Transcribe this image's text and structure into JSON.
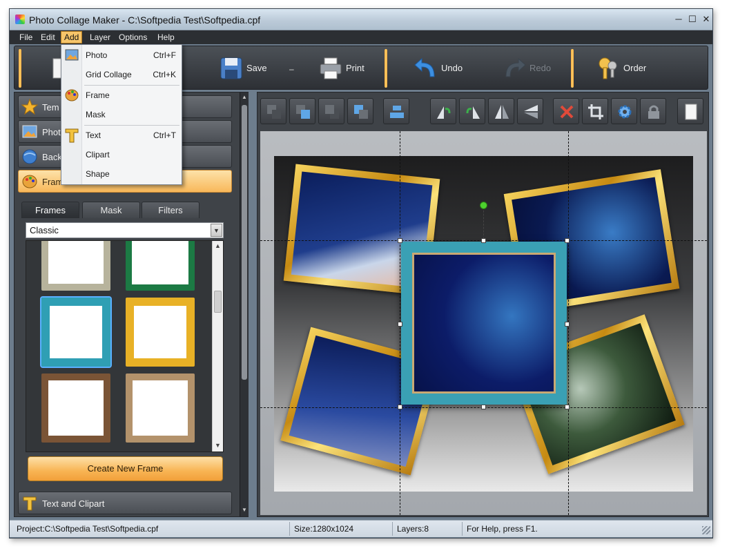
{
  "window": {
    "title": "Photo Collage Maker - C:\\Softpedia Test\\Softpedia.cpf",
    "minimize": "─",
    "maximize": "☐",
    "close": "✕"
  },
  "menubar": {
    "items": [
      "File",
      "Edit",
      "Add",
      "Layer",
      "Options",
      "Help"
    ],
    "active": "Add"
  },
  "toolbar": {
    "save_label": "Save",
    "print_label": "Print",
    "undo_label": "Undo",
    "redo_label": "Redo",
    "order_label": "Order",
    "dash": "–"
  },
  "add_menu": {
    "items": [
      {
        "label": "Photo",
        "shortcut": "Ctrl+F",
        "icon": "photo-icon"
      },
      {
        "label": "Grid Collage",
        "shortcut": "Ctrl+K",
        "icon": ""
      },
      {
        "label": "Frame",
        "shortcut": "",
        "icon": "palette-icon"
      },
      {
        "label": "Mask",
        "shortcut": "",
        "icon": ""
      },
      {
        "label": "Text",
        "shortcut": "Ctrl+T",
        "icon": "text-t-icon"
      },
      {
        "label": "Clipart",
        "shortcut": "",
        "icon": ""
      },
      {
        "label": "Shape",
        "shortcut": "",
        "icon": ""
      }
    ]
  },
  "left_panel": {
    "accordion": [
      {
        "label": "Tem",
        "icon": "star-icon"
      },
      {
        "label": "Phot",
        "icon": "photo-icon"
      },
      {
        "label": "Back",
        "icon": "background-icon"
      },
      {
        "label": "Frames and Effects",
        "icon": "palette-icon"
      }
    ],
    "tabs": [
      "Frames",
      "Mask",
      "Filters"
    ],
    "active_tab": "Frames",
    "frame_style": "Classic",
    "create_button": "Create New Frame",
    "bottom_section": "Text and Clipart"
  },
  "statusbar": {
    "project": "Project:C:\\Softpedia Test\\Softpedia.cpf",
    "size": "Size:1280x1024",
    "layers": "Layers:8",
    "help": "For Help, press F1."
  },
  "colors": {
    "accent_orange": "#f8b453",
    "menu_highlight": "#f7c56a",
    "selected_frame": "#3aa0b4",
    "gold_frame": "#e0b030"
  }
}
